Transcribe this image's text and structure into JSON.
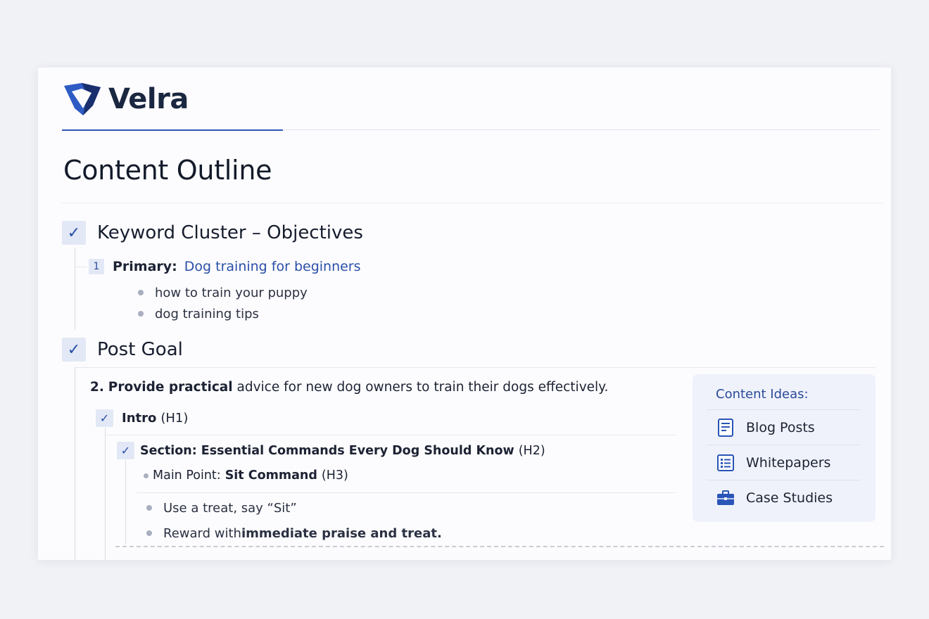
{
  "brand": {
    "name": "Velra",
    "accent": "#2f57b8"
  },
  "page": {
    "title": "Content Outline"
  },
  "sections": [
    {
      "title": "Keyword Cluster – Objectives",
      "checked": true,
      "primary": {
        "number": "1",
        "label": "Primary:",
        "value": "Dog training for beginners"
      },
      "secondary": [
        "how to train your puppy",
        "dog training tips"
      ]
    },
    {
      "title": "Post Goal",
      "checked": true,
      "goal": {
        "number": "2.",
        "strong": "Provide practical",
        "rest": " advice for new dog owners to train their dogs effectively."
      },
      "intro": {
        "label": "Intro",
        "tag": "(H1)"
      },
      "h2": {
        "label": "Section: Essential Commands Every Dog Should Know",
        "tag": "(H2)"
      },
      "h3": {
        "prefix": "Main Point: ",
        "label": "Sit Command",
        "tag": "(H3)"
      },
      "steps": [
        {
          "text": "Use a treat, say “Sit”",
          "strong": ""
        },
        {
          "text": "Reward with ",
          "strong": "immediate praise and treat."
        }
      ]
    }
  ],
  "content_ideas": {
    "title": "Content Ideas:",
    "items": [
      {
        "label": "Blog Posts",
        "icon": "document-icon"
      },
      {
        "label": "Whitepapers",
        "icon": "list-document-icon"
      },
      {
        "label": "Case Studies",
        "icon": "briefcase-icon"
      }
    ]
  }
}
